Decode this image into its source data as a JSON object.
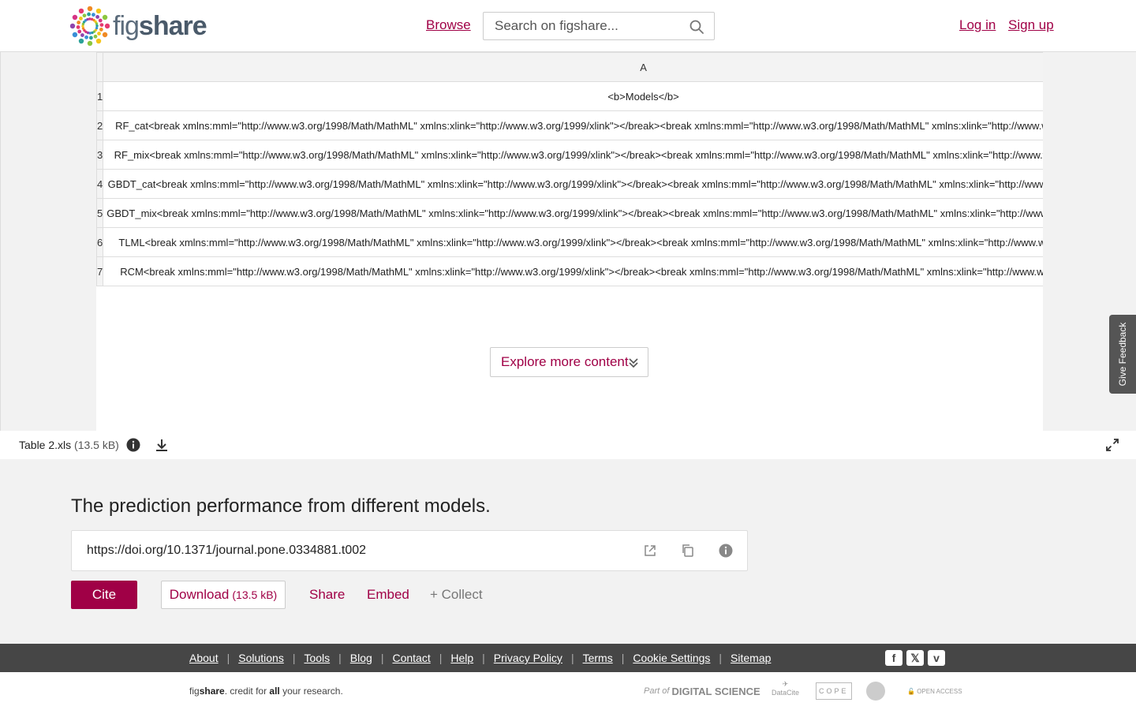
{
  "header": {
    "logo_fig": "fig",
    "logo_share": "share",
    "browse": "Browse",
    "search_placeholder": "Search on figshare...",
    "login": "Log in",
    "signup": "Sign up"
  },
  "sheet": {
    "column_header": "A",
    "rows": [
      {
        "num": "1",
        "value": "<b>Models</b>"
      },
      {
        "num": "2",
        "value": "RF_cat<break xmlns:mml=\"http://www.w3.org/1998/Math/MathML\" xmlns:xlink=\"http://www.w3.org/1999/xlink\"></break><break xmlns:mml=\"http://www.w3.org/1998/Math/MathML\" xmlns:xlink=\"http://www.w3.org/1999/xlink\"></break>"
      },
      {
        "num": "3",
        "value": "RF_mix<break xmlns:mml=\"http://www.w3.org/1998/Math/MathML\" xmlns:xlink=\"http://www.w3.org/1999/xlink\"></break><break xmlns:mml=\"http://www.w3.org/1998/Math/MathML\" xmlns:xlink=\"http://www.w3.org/1999/xlink\"></break>"
      },
      {
        "num": "4",
        "value": "GBDT_cat<break xmlns:mml=\"http://www.w3.org/1998/Math/MathML\" xmlns:xlink=\"http://www.w3.org/1999/xlink\"></break><break xmlns:mml=\"http://www.w3.org/1998/Math/MathML\" xmlns:xlink=\"http://www.w3.org/1999/xlink\"></break>"
      },
      {
        "num": "5",
        "value": "GBDT_mix<break xmlns:mml=\"http://www.w3.org/1998/Math/MathML\" xmlns:xlink=\"http://www.w3.org/1999/xlink\"></break><break xmlns:mml=\"http://www.w3.org/1998/Math/MathML\" xmlns:xlink=\"http://www.w3.org/1999/xlink\"></break>"
      },
      {
        "num": "6",
        "value": "TLML<break xmlns:mml=\"http://www.w3.org/1998/Math/MathML\" xmlns:xlink=\"http://www.w3.org/1999/xlink\"></break><break xmlns:mml=\"http://www.w3.org/1998/Math/MathML\" xmlns:xlink=\"http://www.w3.org/1999/xlink\"></break>"
      },
      {
        "num": "7",
        "value": "RCM<break xmlns:mml=\"http://www.w3.org/1998/Math/MathML\" xmlns:xlink=\"http://www.w3.org/1999/xlink\"></break><break xmlns:mml=\"http://www.w3.org/1998/Math/MathML\" xmlns:xlink=\"http://www.w3.org/1999/xlink\"></break>"
      }
    ]
  },
  "viewer": {
    "explore_label": "Explore more content",
    "feedback_label": "Give Feedback"
  },
  "file": {
    "name": "Table 2.xls",
    "size": "(13.5 kB)"
  },
  "item": {
    "title": "The prediction performance from different models.",
    "doi": "https://doi.org/10.1371/journal.pone.0334881.t002",
    "cite": "Cite",
    "download": "Download",
    "download_size": "(13.5 kB)",
    "share": "Share",
    "embed": "Embed",
    "collect": "+ Collect"
  },
  "footer": {
    "links": [
      "About",
      "Solutions",
      "Tools",
      "Blog",
      "Contact",
      "Help",
      "Privacy Policy",
      "Terms",
      "Cookie Settings",
      "Sitemap"
    ],
    "tagline_fig": "fig",
    "tagline_share": "share",
    "tagline_mid": ". credit for ",
    "tagline_all": "all",
    "tagline_end": " your research.",
    "partners": {
      "part_of": "Part of",
      "digital_science": "DIGITAL SCIENCE",
      "datacite": "DataCite",
      "cope": "COPE",
      "open_access": "OPEN ACCESS"
    }
  },
  "colors": {
    "brand": "#a00046",
    "footer_bg": "#464646",
    "page_bg": "#f2f2f2"
  }
}
